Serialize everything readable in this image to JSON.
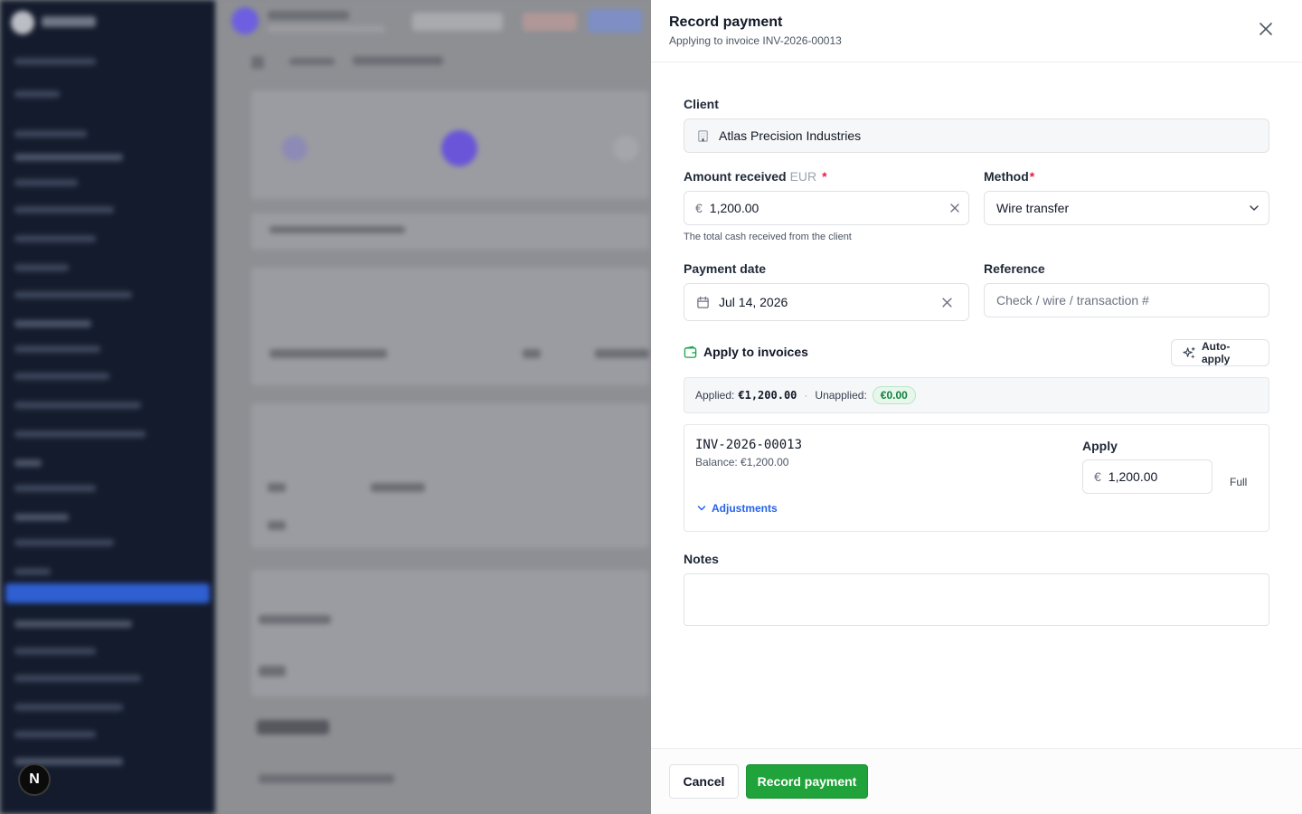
{
  "drawer": {
    "title": "Record payment",
    "subtitle": "Applying to invoice INV-2026-00013",
    "close_icon": "close-icon"
  },
  "form": {
    "client": {
      "label": "Client",
      "value": "Atlas Precision Industries",
      "icon": "building-icon"
    },
    "amount": {
      "label": "Amount received",
      "currency": "EUR",
      "required_mark": "*",
      "prefix": "€",
      "value": "1,200.00",
      "hint": "The total cash received from the client"
    },
    "method": {
      "label": "Method",
      "required_mark": "*",
      "value": "Wire transfer"
    },
    "payment_date": {
      "label": "Payment date",
      "value": "Jul 14, 2026",
      "icon": "calendar-icon"
    },
    "reference": {
      "label": "Reference",
      "placeholder": "Check / wire / transaction #"
    },
    "notes": {
      "label": "Notes",
      "value": ""
    }
  },
  "apply": {
    "title": "Apply to invoices",
    "auto_apply_label": "Auto-apply",
    "summary": {
      "applied_label": "Applied:",
      "applied_value": "€1,200.00",
      "separator": "·",
      "unapplied_label": "Unapplied:",
      "unapplied_value": "€0.00"
    },
    "invoices": [
      {
        "number": "INV-2026-00013",
        "balance": "Balance: €1,200.00",
        "apply_label": "Apply",
        "apply_prefix": "€",
        "apply_value": "1,200.00",
        "full_label": "Full",
        "adjustments_label": "Adjustments"
      }
    ]
  },
  "footer": {
    "cancel_label": "Cancel",
    "submit_label": "Record payment"
  },
  "colors": {
    "primary": "#1fa33a",
    "link": "#2563eb",
    "required": "#e11d48",
    "badge_bg": "#e7f7ec",
    "sidebar_bg": "#141b2d"
  },
  "floating_badge": "N"
}
